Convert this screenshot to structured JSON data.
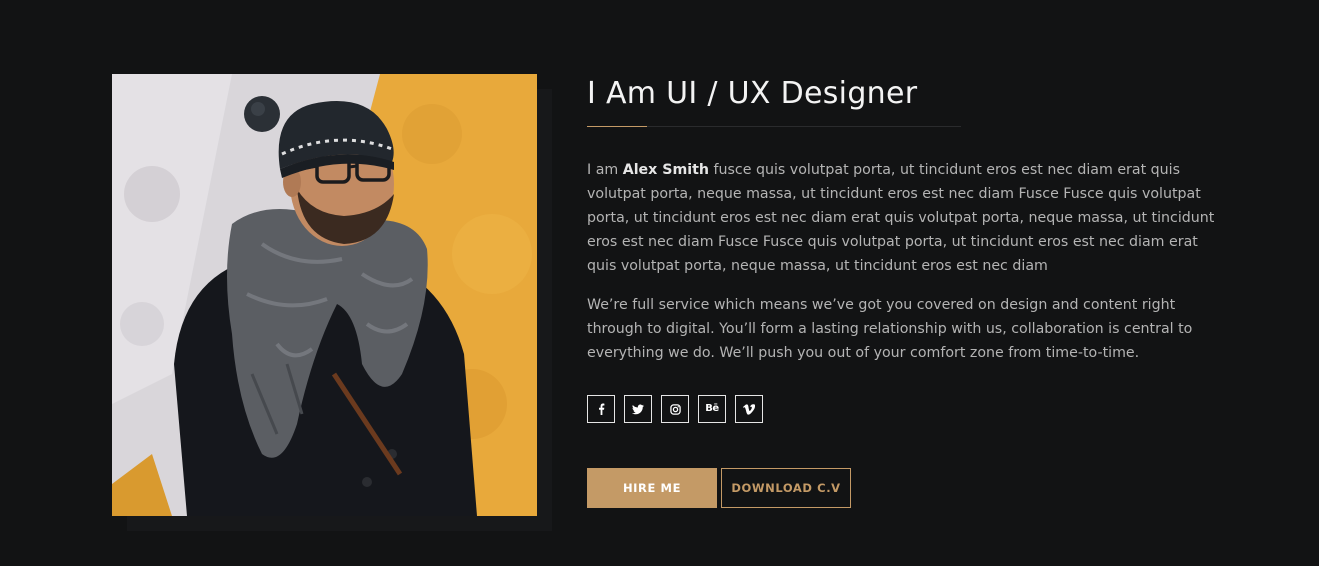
{
  "about": {
    "title": "I Am UI / UX Designer",
    "intro_prefix": "I am ",
    "name": "Alex Smith",
    "intro_body": " fusce quis volutpat porta, ut tincidunt eros est nec diam erat quis volutpat porta, neque massa, ut tincidunt eros est nec diam Fusce Fusce quis volutpat porta, ut tincidunt eros est nec diam erat quis volutpat porta, neque massa, ut tincidunt eros est nec diam Fusce Fusce quis volutpat porta, ut tincidunt eros est nec diam erat quis volutpat porta, neque massa, ut tincidunt eros est nec diam",
    "paragraph_2": "We’re full service which means we’ve got you covered on design and content right through to digital. You’ll form a lasting relationship with us, collaboration is central to everything we do. We’ll push you out of your comfort zone from time-to-time."
  },
  "socials": [
    {
      "icon": "facebook-icon",
      "glyph": "f"
    },
    {
      "icon": "twitter-icon",
      "glyph": ""
    },
    {
      "icon": "instagram-icon",
      "glyph": ""
    },
    {
      "icon": "behance-icon",
      "glyph": "Bē"
    },
    {
      "icon": "vimeo-icon",
      "glyph": "v"
    }
  ],
  "buttons": {
    "hire_label": "HIRE ME",
    "download_label": "DOWNLOAD C.V"
  },
  "colors": {
    "background": "#121314",
    "accent": "#c49a66",
    "heading": "#f3f3f3",
    "body_text": "#b4b4b4"
  }
}
